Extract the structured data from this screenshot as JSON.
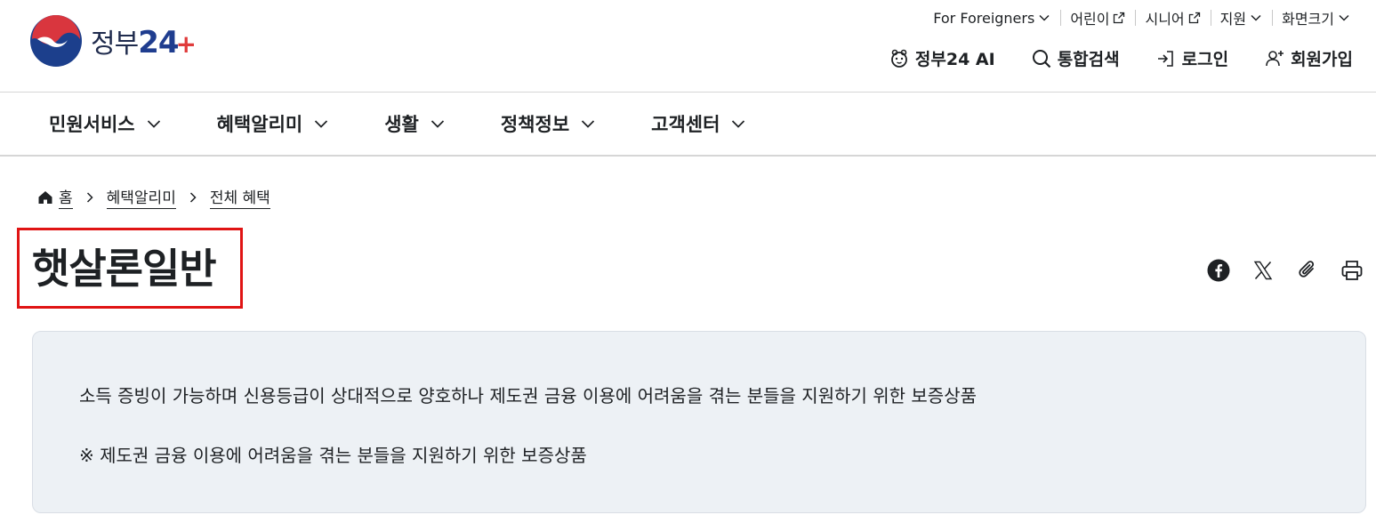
{
  "logo": {
    "text": "정부",
    "num": "24",
    "plus": "+"
  },
  "util_nav": [
    {
      "label": "For Foreigners",
      "icon": "chevron-down-icon"
    },
    {
      "label": "어린이",
      "icon": "external-link-icon"
    },
    {
      "label": "시니어",
      "icon": "external-link-icon"
    },
    {
      "label": "지원",
      "icon": "chevron-down-icon"
    },
    {
      "label": "화면크기",
      "icon": "chevron-down-icon"
    }
  ],
  "main_util": [
    {
      "label": "정부24 AI",
      "icon": "ai-mascot-icon"
    },
    {
      "label": "통합검색",
      "icon": "search-icon"
    },
    {
      "label": "로그인",
      "icon": "login-icon"
    },
    {
      "label": "회원가입",
      "icon": "user-plus-icon"
    }
  ],
  "gnb": [
    {
      "label": "민원서비스"
    },
    {
      "label": "혜택알리미"
    },
    {
      "label": "생활"
    },
    {
      "label": "정책정보"
    },
    {
      "label": "고객센터"
    }
  ],
  "breadcrumb": [
    "홈",
    "혜택알리미",
    "전체 혜택"
  ],
  "page_title": "햇살론일반",
  "share_icons": [
    "facebook-icon",
    "x-icon",
    "link-icon",
    "print-icon"
  ],
  "summary": {
    "line1": "소득 증빙이 가능하며 신용등급이 상대적으로 양호하나 제도권 금융 이용에 어려움을 겪는 분들을 지원하기 위한 보증상품",
    "line2": "※ 제도권 금융 이용에 어려움을 겪는 분들을 지원하기 위한 보증상품"
  },
  "colors": {
    "highlight_border": "#e01414",
    "summary_bg": "#edf1f5",
    "text": "#1e2124",
    "brand_blue": "#1f3d8f",
    "brand_red": "#e03b3b"
  }
}
